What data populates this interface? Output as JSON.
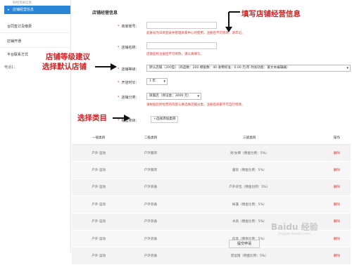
{
  "sidebar": {
    "top_text": "财经资质信息",
    "active_item": "店铺经营信息",
    "items": [
      "合同签订及缴费",
      "店铺开通",
      "平台联系方式"
    ],
    "phone_label": "电话1："
  },
  "form": {
    "section_title": "店铺经营信息",
    "merchant_account_label": "商家账号：",
    "merchant_account_hint": "此账号为日商登录并管理商家中心时使用，注册后不可修改，请牢记。",
    "shop_name_label": "店铺名称：",
    "shop_name_hint": "店铺名称注册后不可修改，请认真填写。",
    "shop_level_label": "店铺等级：",
    "shop_level_value": "默认店铺（200型）（商品数：200 模板数：40 收费标准：0.00 元/年 附加功能：富文本编辑器）",
    "duration_label": "开店时长：",
    "duration_value": "1 年",
    "category_label": "店铺分类：",
    "category_value": "旗舰店（保证金：3000 元）",
    "category_hint": "请根据您所经营的内容认真选择店铺分类，注册后商家不可自行修改。",
    "business_category_label": "经营类目：",
    "add_category_button": "+选择添加类目"
  },
  "annotations": {
    "fill_info": "填写店铺经营信息",
    "level_line1": "店铺等级建议",
    "level_line2": "选择默认店铺",
    "select_category": "选择类目"
  },
  "table": {
    "headers": [
      "一级类目",
      "二级类目",
      "三级类目",
      "操作"
    ],
    "rows": [
      {
        "c1": "户外 运动",
        "c2": "户外服饰",
        "c3": "男/女裤（佣金比例：5%）",
        "op": "删除"
      },
      {
        "c1": "户外 运动",
        "c2": "户外服饰",
        "c3": "童装（佣金比例：5%）",
        "op": "删除"
      },
      {
        "c1": "户外 运动",
        "c2": "户外装备",
        "c3": "户外背包（佣金比例：5%）",
        "op": "删除"
      },
      {
        "c1": "户外 运动",
        "c2": "户外装备",
        "c3": "帐篷（佣金比例：5%）",
        "op": "删除"
      },
      {
        "c1": "户外 运动",
        "c2": "户外装备",
        "c3": "水具（佣金比例：5%）",
        "op": "删除"
      },
      {
        "c1": "户外 运动",
        "c2": "户外装备",
        "c3": "炊具（佣金比例：5%）",
        "op": "删除"
      },
      {
        "c1": "户外 运动",
        "c2": "户外装备",
        "c3": "望远镜（佣金比例：5%）",
        "op": "删除"
      }
    ]
  },
  "submit_label": "提交申请",
  "watermark": {
    "main": "Baidu 经验",
    "sub": "jingyan.baidu.com"
  }
}
